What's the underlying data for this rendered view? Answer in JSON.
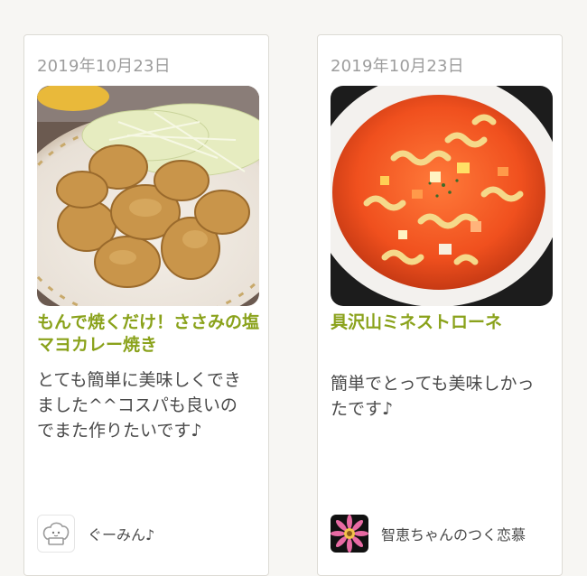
{
  "cards": [
    {
      "date": "2019年10月23日",
      "title": "もんで焼くだけ！ささみの塩マヨカレー焼き",
      "comment": "とても簡単に美味しくできました^^コスパも良いのでまた作りたいです♪",
      "author": "ぐーみん♪",
      "photo_icon": "chicken-photo",
      "avatar_icon": "toque-avatar-icon"
    },
    {
      "date": "2019年10月23日",
      "title": "具沢山ミネストローネ",
      "comment": "簡単でとっても美味しかったです♪",
      "author": "智恵ちゃんのつく恋慕",
      "photo_icon": "minestrone-photo",
      "avatar_icon": "flower-avatar-icon"
    }
  ],
  "colors": {
    "title": "#8aa21b",
    "date": "#9d9d9d",
    "text": "#4a4a4a",
    "background": "#f7f6f3",
    "card": "#ffffff"
  }
}
